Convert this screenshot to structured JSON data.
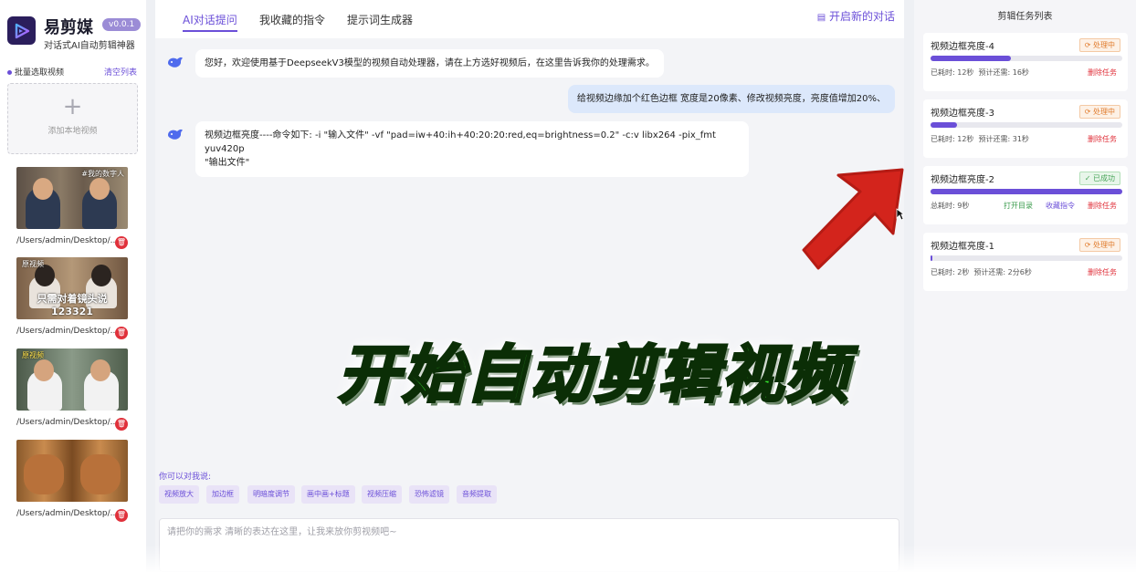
{
  "app": {
    "name": "易剪媒",
    "version": "v0.0.1",
    "tagline": "对话式AI自动剪辑神器"
  },
  "sidebar": {
    "batch_label": "批量选取视频",
    "clear_label": "清空列表",
    "add_label": "添加本地视频",
    "videos": [
      {
        "path": "/Users/admin/Desktop/...",
        "thumb_text": "",
        "thumb_tag": "#我的数字人"
      },
      {
        "path": "/Users/admin/Desktop/...",
        "thumb_text": "只需对着镜头说123321",
        "thumb_tag": "原视频"
      },
      {
        "path": "/Users/admin/Desktop/...",
        "thumb_text": "",
        "thumb_tag": "原视频"
      },
      {
        "path": "/Users/admin/Desktop/...",
        "thumb_text": "",
        "thumb_tag": ""
      }
    ]
  },
  "tabs": {
    "items": [
      "AI对话提问",
      "我收藏的指令",
      "提示词生成器"
    ],
    "new_chat": "开启新的对话"
  },
  "chat": {
    "messages": [
      {
        "role": "bot",
        "text": "您好，欢迎使用基于DeepseekV3模型的视频自动处理器，请在上方选好视频后，在这里告诉我你的处理需求。"
      },
      {
        "role": "user",
        "text": "给视频边缘加个红色边框 宽度是20像素、修改视频亮度，亮度值增加20%、"
      },
      {
        "role": "bot",
        "text_line1": "视频边框亮度----命令如下: -i \"输入文件\" -vf \"pad=iw+40:ih+40:20:20:red,eq=brightness=0.2\" -c:v libx264 -pix_fmt yuv420p",
        "text_line2": "\"输出文件\""
      }
    ],
    "suggest_label": "你可以对我说:",
    "chips": [
      "视频放大",
      "加边框",
      "明暗度调节",
      "画中画+标题",
      "视频压缩",
      "恐怖滤镜",
      "音频提取"
    ],
    "input_placeholder": "请把你的需求 清晰的表达在这里，让我来放你剪视频吧~"
  },
  "overlay": {
    "title": "开始自动剪辑视频"
  },
  "tasks": {
    "title": "剪辑任务列表",
    "items": [
      {
        "name": "视频边框亮度-4",
        "status": "处理中",
        "status_type": "processing",
        "progress": 0.42,
        "elapsed": "已耗时: 12秒",
        "remaining": "预计还需: 16秒",
        "delete": "删除任务"
      },
      {
        "name": "视频边框亮度-3",
        "status": "处理中",
        "status_type": "processing",
        "progress": 0.14,
        "elapsed": "已耗时: 12秒",
        "remaining": "预计还需: 31秒",
        "delete": "删除任务"
      },
      {
        "name": "视频边框亮度-2",
        "status": "已成功",
        "status_type": "success",
        "progress": 1.0,
        "elapsed": "总耗时: 9秒",
        "open_dir": "打开目录",
        "favorite": "收藏指令",
        "delete": "删除任务"
      },
      {
        "name": "视频边框亮度-1",
        "status": "处理中",
        "status_type": "processing",
        "progress": 0.01,
        "elapsed": "已耗时: 2秒",
        "remaining": "预计还需: 2分6秒",
        "delete": "删除任务"
      }
    ]
  },
  "colors": {
    "accent": "#6b4fd8",
    "danger": "#e0313b",
    "success": "#4aa55b",
    "warning": "#e07b2c"
  }
}
